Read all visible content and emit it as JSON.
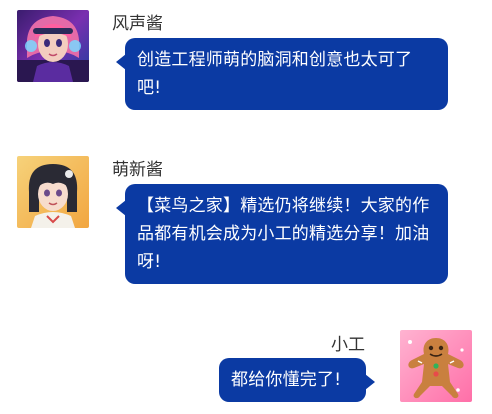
{
  "colors": {
    "bubble": "#0b3aa3",
    "bubble_text": "#ffffff",
    "name_text": "#333333",
    "background": "#ffffff"
  },
  "messages": [
    {
      "sender": "风声酱",
      "text": "创造工程师萌的脑洞和创意也太可了吧!",
      "side": "left",
      "avatar": "anime-girl-pink-hair-headphones-avatar"
    },
    {
      "sender": "萌新酱",
      "text": "【菜鸟之家】精选仍将继续！大家的作品都有机会成为小工的精选分享！加油呀!",
      "side": "left",
      "avatar": "anime-girl-black-bob-hair-avatar"
    },
    {
      "sender": "小工",
      "text": "都给你懂完了!",
      "side": "right",
      "avatar": "gingerbread-man-avatar"
    }
  ]
}
